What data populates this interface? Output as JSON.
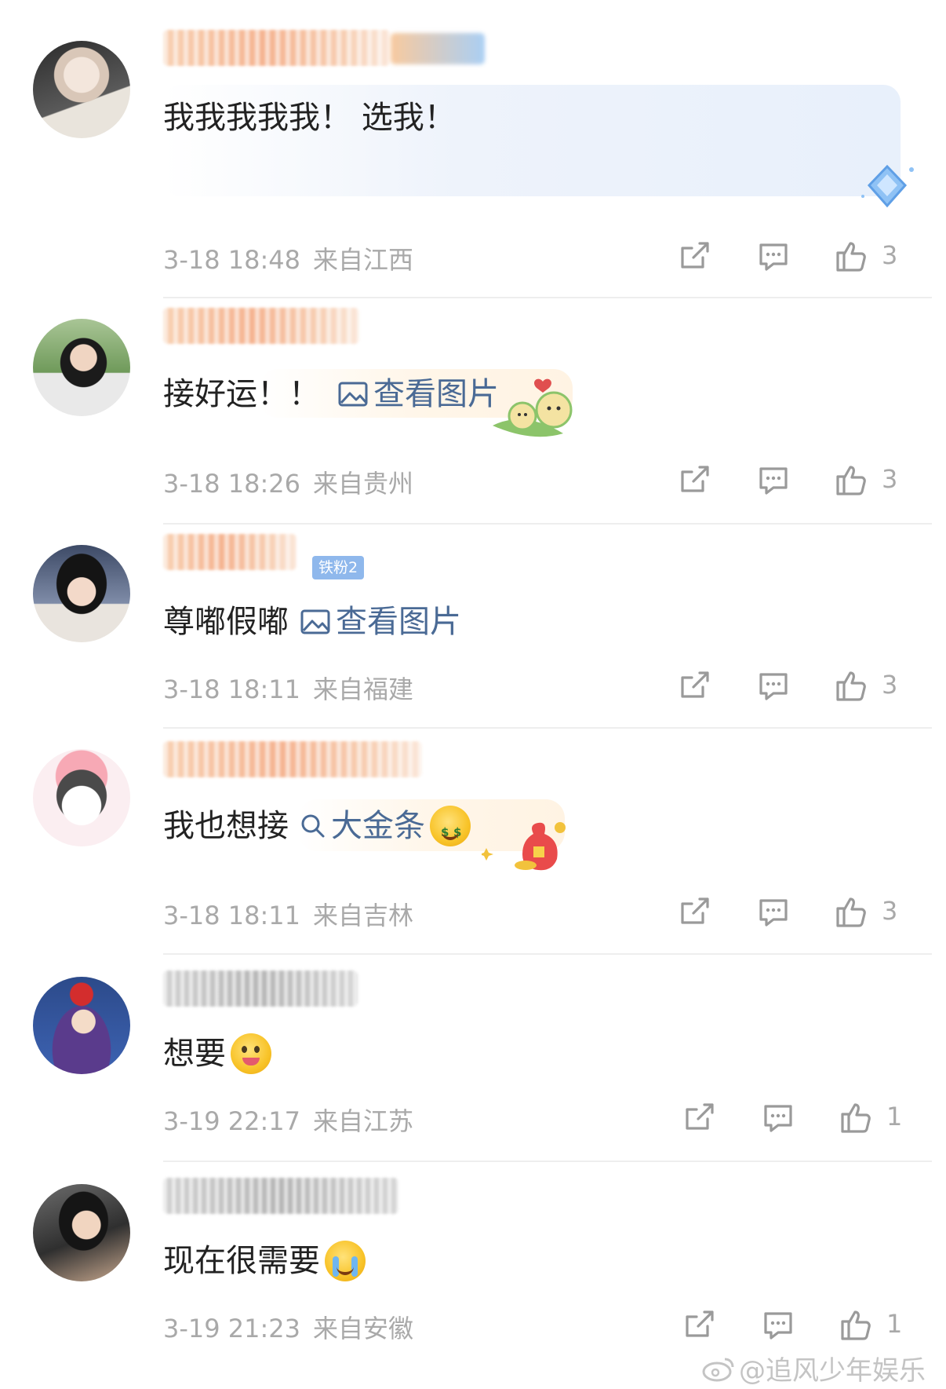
{
  "comments": [
    {
      "text": "我我我我我！ 选我！",
      "time": "3-18 18:48",
      "location": "来自江西",
      "likes": "3"
    },
    {
      "text": "接好运！！",
      "link": "查看图片",
      "time": "3-18 18:26",
      "location": "来自贵州",
      "likes": "3"
    },
    {
      "text": "尊嘟假嘟",
      "link": "查看图片",
      "badge": "铁粉2",
      "time": "3-18 18:11",
      "location": "来自福建",
      "likes": "3"
    },
    {
      "text": "我也想接",
      "search_link": "大金条",
      "time": "3-18 18:11",
      "location": "来自吉林",
      "likes": "3"
    },
    {
      "text": "想要",
      "time": "3-19 22:17",
      "location": "来自江苏",
      "likes": "1"
    },
    {
      "text": "现在很需要",
      "time": "3-19 21:23",
      "location": "来自安徽",
      "likes": "1"
    }
  ],
  "icons": {
    "share": "share-icon",
    "comment": "comment-icon",
    "like": "thumbs-up-icon",
    "image": "image-icon",
    "search": "search-icon"
  },
  "colors": {
    "link": "#4a6a95",
    "meta": "#a9a9a9",
    "text": "#222222"
  },
  "watermark": {
    "text": "@追风少年娱乐"
  }
}
